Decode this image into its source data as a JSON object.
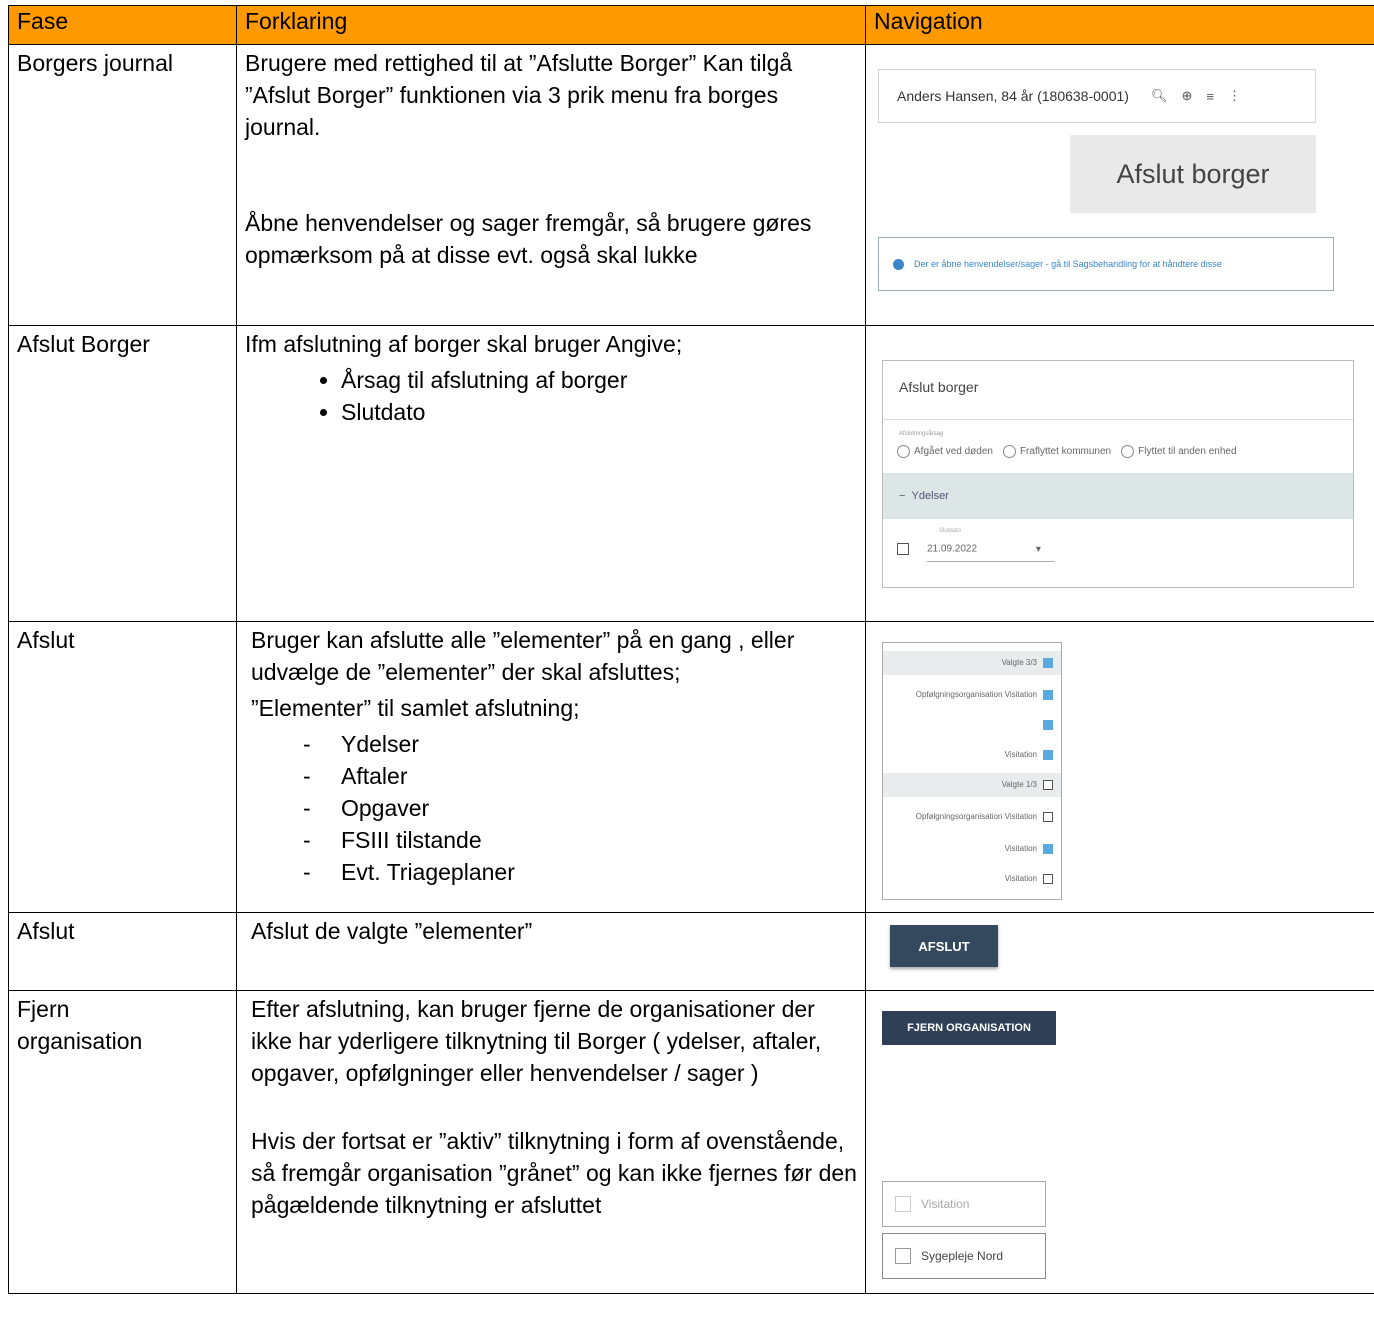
{
  "headers": [
    "Fase",
    "Forklaring",
    "Navigation"
  ],
  "rows": {
    "r1": {
      "fase": "Borgers journal",
      "forklaring_p1": "Brugere med rettighed til at ”Afslutte Borger” Kan tilgå ”Afslut Borger” funktionen via 3 prik menu fra borges journal.",
      "forklaring_p2": "Åbne henvendelser og sager fremgår, så brugere gøres opmærksom på at disse evt. også skal lukke",
      "nav": {
        "search_text": "Anders Hansen, 84 år (180638-0001)",
        "afslut_button": "Afslut borger",
        "info_text": "Der er åbne henvendelser/sager - gå til Sagsbehandling for at håndtere disse"
      }
    },
    "r2": {
      "fase": "Afslut Borger",
      "intro": "Ifm afslutning af borger skal bruger Angive;",
      "bullets": [
        "Årsag til afslutning af borger",
        "Slutdato"
      ],
      "nav": {
        "dialog_title": "Afslut borger",
        "reason_label": "Afslutningsårsag",
        "radios": [
          "Afgået ved døden",
          "Fraflyttet kommunen",
          "Flyttet til anden enhed"
        ],
        "section": "Ydelser",
        "date_label": "Slutdato",
        "date_value": "21.09.2022"
      }
    },
    "r3": {
      "fase": "Afslut",
      "intro": "Bruger kan afslutte alle ”elementer” på en gang , eller udvælge de ”elementer” der skal afsluttes;",
      "sub": "”Elementer” til samlet afslutning;",
      "items": [
        "Ydelser",
        "Aftaler",
        "Opgaver",
        "FSIII tilstande",
        "Evt. Triageplaner"
      ],
      "nav": {
        "list": [
          "Valgte 3/3",
          "Opfølgningsorganisation Visitation",
          "",
          "Visitation",
          "Valgte 1/3",
          "Opfølgningsorganisation Visitation",
          "Visitation",
          "Visitation"
        ]
      }
    },
    "r4": {
      "fase": "Afslut",
      "forklaring": "Afslut de valgte ”elementer”",
      "nav": {
        "button": "AFSLUT"
      }
    },
    "r5": {
      "fase": "Fjern organisation",
      "forklaring_p1": "Efter afslutning, kan bruger fjerne de organisationer der ikke har yderligere tilknytning til Borger ( ydelser, aftaler, opgaver, opfølgninger eller henvendelser / sager )",
      "forklaring_p2": "Hvis der fortsat er ”aktiv” tilknytning i form af ovenstående, så fremgår organisation ”grånet” og kan ikke fjernes før den pågældende tilknytning er afsluttet",
      "nav": {
        "button": "FJERN ORGANISATION",
        "org1": "Visitation",
        "org2": "Sygepleje Nord"
      }
    }
  }
}
